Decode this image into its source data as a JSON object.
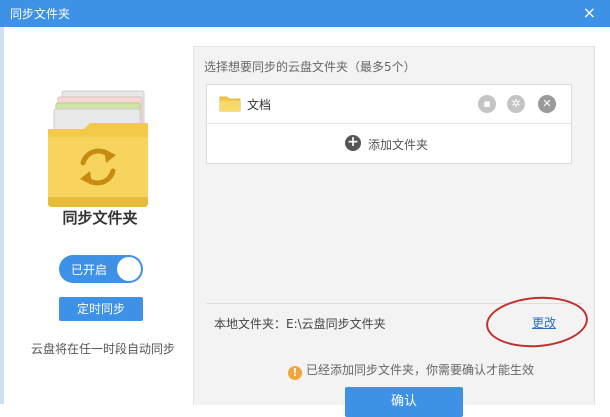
{
  "window": {
    "title": "同步文件夹",
    "close_glyph": "×"
  },
  "left": {
    "icon": "sync-folder-icon",
    "title": "同步文件夹",
    "toggle_label": "已开启",
    "timer_button": "定时同步",
    "description": "云盘将在任一时段自动同步"
  },
  "right": {
    "hint": "选择想要同步的云盘文件夹（最多5个）",
    "folders": [
      {
        "name": "文档",
        "icons": [
          "folder-icon",
          "open-icon",
          "settings-icon",
          "remove-icon"
        ]
      }
    ],
    "add_label": "添加文件夹",
    "local_folder_label": "本地文件夹：E:\\云盘同步文件夹",
    "change_link": "更改",
    "notice": "已经添加同步文件夹，你需要确认才能生效",
    "confirm_button": "确认"
  },
  "colors": {
    "accent": "#3d91e6",
    "annotation": "#c0312e",
    "link": "#2b6fc2"
  }
}
